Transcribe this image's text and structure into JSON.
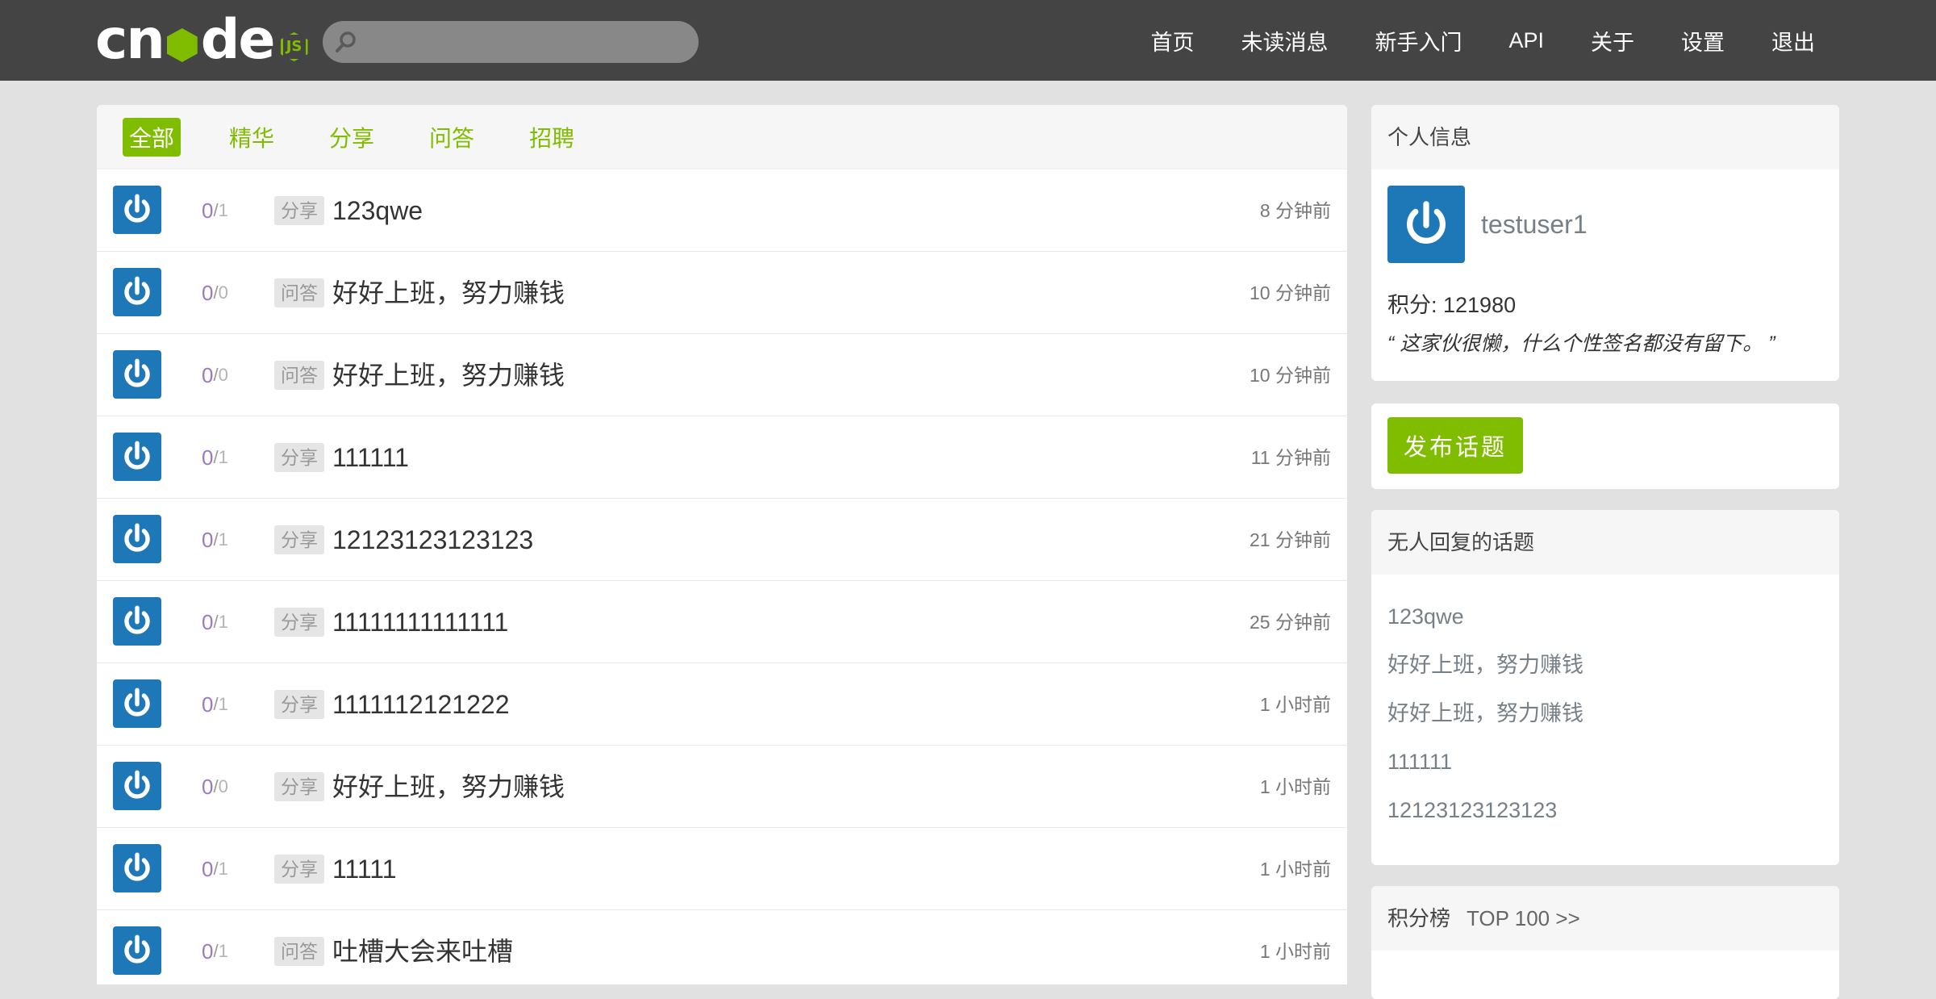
{
  "navbar": {
    "brand": "cnode",
    "brand_badge": "JS",
    "search_placeholder": "",
    "links": [
      "首页",
      "未读消息",
      "新手入门",
      "API",
      "关于",
      "设置",
      "退出"
    ]
  },
  "tabs": [
    "全部",
    "精华",
    "分享",
    "问答",
    "招聘"
  ],
  "active_tab": "全部",
  "topics": [
    {
      "reply": "0",
      "visit": "1",
      "tag": "分享",
      "title": "123qwe",
      "time": "8 分钟前"
    },
    {
      "reply": "0",
      "visit": "0",
      "tag": "问答",
      "title": "好好上班，努力赚钱",
      "time": "10 分钟前"
    },
    {
      "reply": "0",
      "visit": "0",
      "tag": "问答",
      "title": "好好上班，努力赚钱",
      "time": "10 分钟前"
    },
    {
      "reply": "0",
      "visit": "1",
      "tag": "分享",
      "title": "111111",
      "time": "11 分钟前"
    },
    {
      "reply": "0",
      "visit": "1",
      "tag": "分享",
      "title": "12123123123123",
      "time": "21 分钟前"
    },
    {
      "reply": "0",
      "visit": "1",
      "tag": "分享",
      "title": "11111111111111",
      "time": "25 分钟前"
    },
    {
      "reply": "0",
      "visit": "1",
      "tag": "分享",
      "title": "1111112121222",
      "time": "1 小时前"
    },
    {
      "reply": "0",
      "visit": "0",
      "tag": "分享",
      "title": "好好上班，努力赚钱",
      "time": "1 小时前"
    },
    {
      "reply": "0",
      "visit": "1",
      "tag": "分享",
      "title": "11111",
      "time": "1 小时前"
    },
    {
      "reply": "0",
      "visit": "1",
      "tag": "问答",
      "title": "吐槽大会来吐槽",
      "time": "1 小时前"
    }
  ],
  "sidebar": {
    "user_info": {
      "header": "个人信息",
      "username": "testuser1",
      "score": "积分: 121980",
      "signature": "“ 这家伙很懒，什么个性签名都没有留下。 ”"
    },
    "create_topic_label": "发布话题",
    "no_reply": {
      "header": "无人回复的话题",
      "items": [
        "123qwe",
        "好好上班，努力赚钱",
        "好好上班，努力赚钱",
        "111111",
        "12123123123123"
      ]
    },
    "rank": {
      "header": "积分榜",
      "top_link": "TOP 100 >>"
    }
  },
  "colors": {
    "navbar_bg": "#444444",
    "accent_green": "#80bd01",
    "avatar_blue": "#1e78b8",
    "reply_purple": "#9e78c0",
    "page_bg": "#e1e1e1"
  },
  "icons": {
    "search": "search-icon",
    "avatar": "power-symbol-avatar"
  }
}
